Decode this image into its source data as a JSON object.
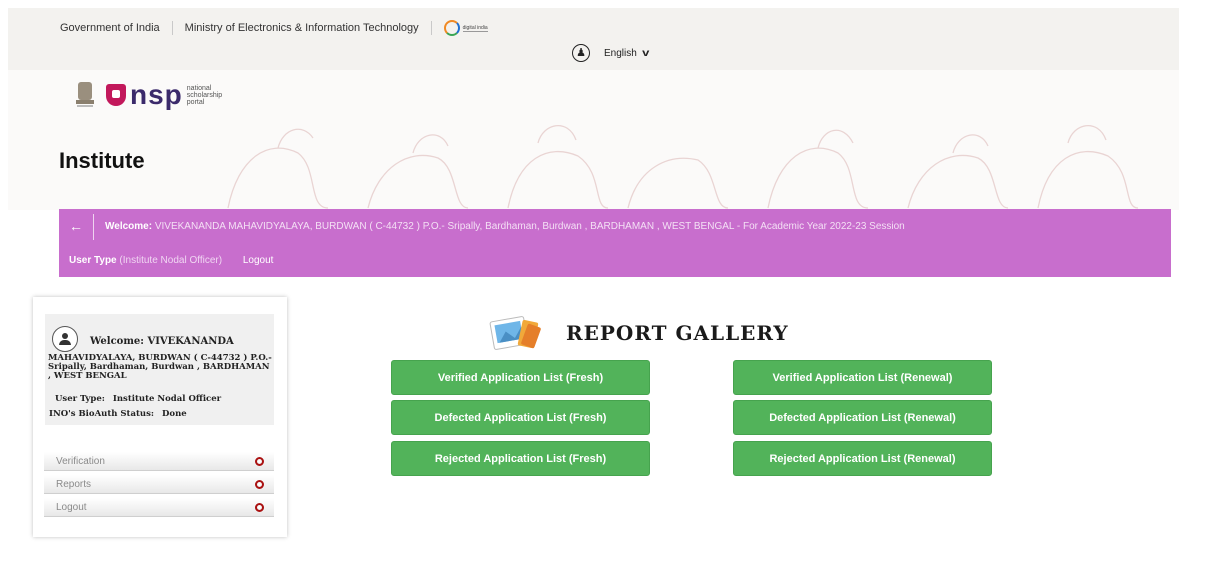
{
  "gov_bar": {
    "government": "Government of India",
    "ministry": "Ministry of Electronics & Information Technology",
    "digital_india_tag": "digital india",
    "language": "English"
  },
  "header": {
    "logo_text": "nsp",
    "logo_sub": "national scholarship portal",
    "title": "Institute"
  },
  "welcome_bar": {
    "welcome_label": "Welcome:",
    "welcome_text": "VIVEKANANDA MAHAVIDYALAYA, BURDWAN ( C-44732 ) P.O.- Sripally, Bardhaman, Burdwan , BARDHAMAN , WEST BENGAL - For Academic Year 2022-23 Session",
    "user_type_label": "User Type",
    "user_type_value": "(Institute Nodal Officer)",
    "logout": "Logout"
  },
  "sidebar": {
    "welcome": "Welcome: VIVEKANANDA",
    "institute": "MAHAVIDYALAYA, BURDWAN ( C-44732 ) P.O.- Sripally, Bardhaman, Burdwan , BARDHAMAN , WEST BENGAL",
    "user_type_label": "User Type:",
    "user_type_value": "Institute Nodal Officer",
    "bioauth_label": "INO's BioAuth Status:",
    "bioauth_value": "Done",
    "menu": [
      {
        "label": "Verification"
      },
      {
        "label": "Reports"
      },
      {
        "label": "Logout"
      }
    ]
  },
  "gallery": {
    "title": "REPORT GALLERY",
    "buttons": [
      "Verified Application List (Fresh)",
      "Verified Application List (Renewal)",
      "Defected Application List (Fresh)",
      "Defected Application List (Renewal)",
      "Rejected Application List (Fresh)",
      "Rejected Application List (Renewal)"
    ]
  },
  "colors": {
    "welcome_bar": "#c86ecd",
    "button_green": "#52b35a",
    "nsp_pink": "#c2185b"
  }
}
